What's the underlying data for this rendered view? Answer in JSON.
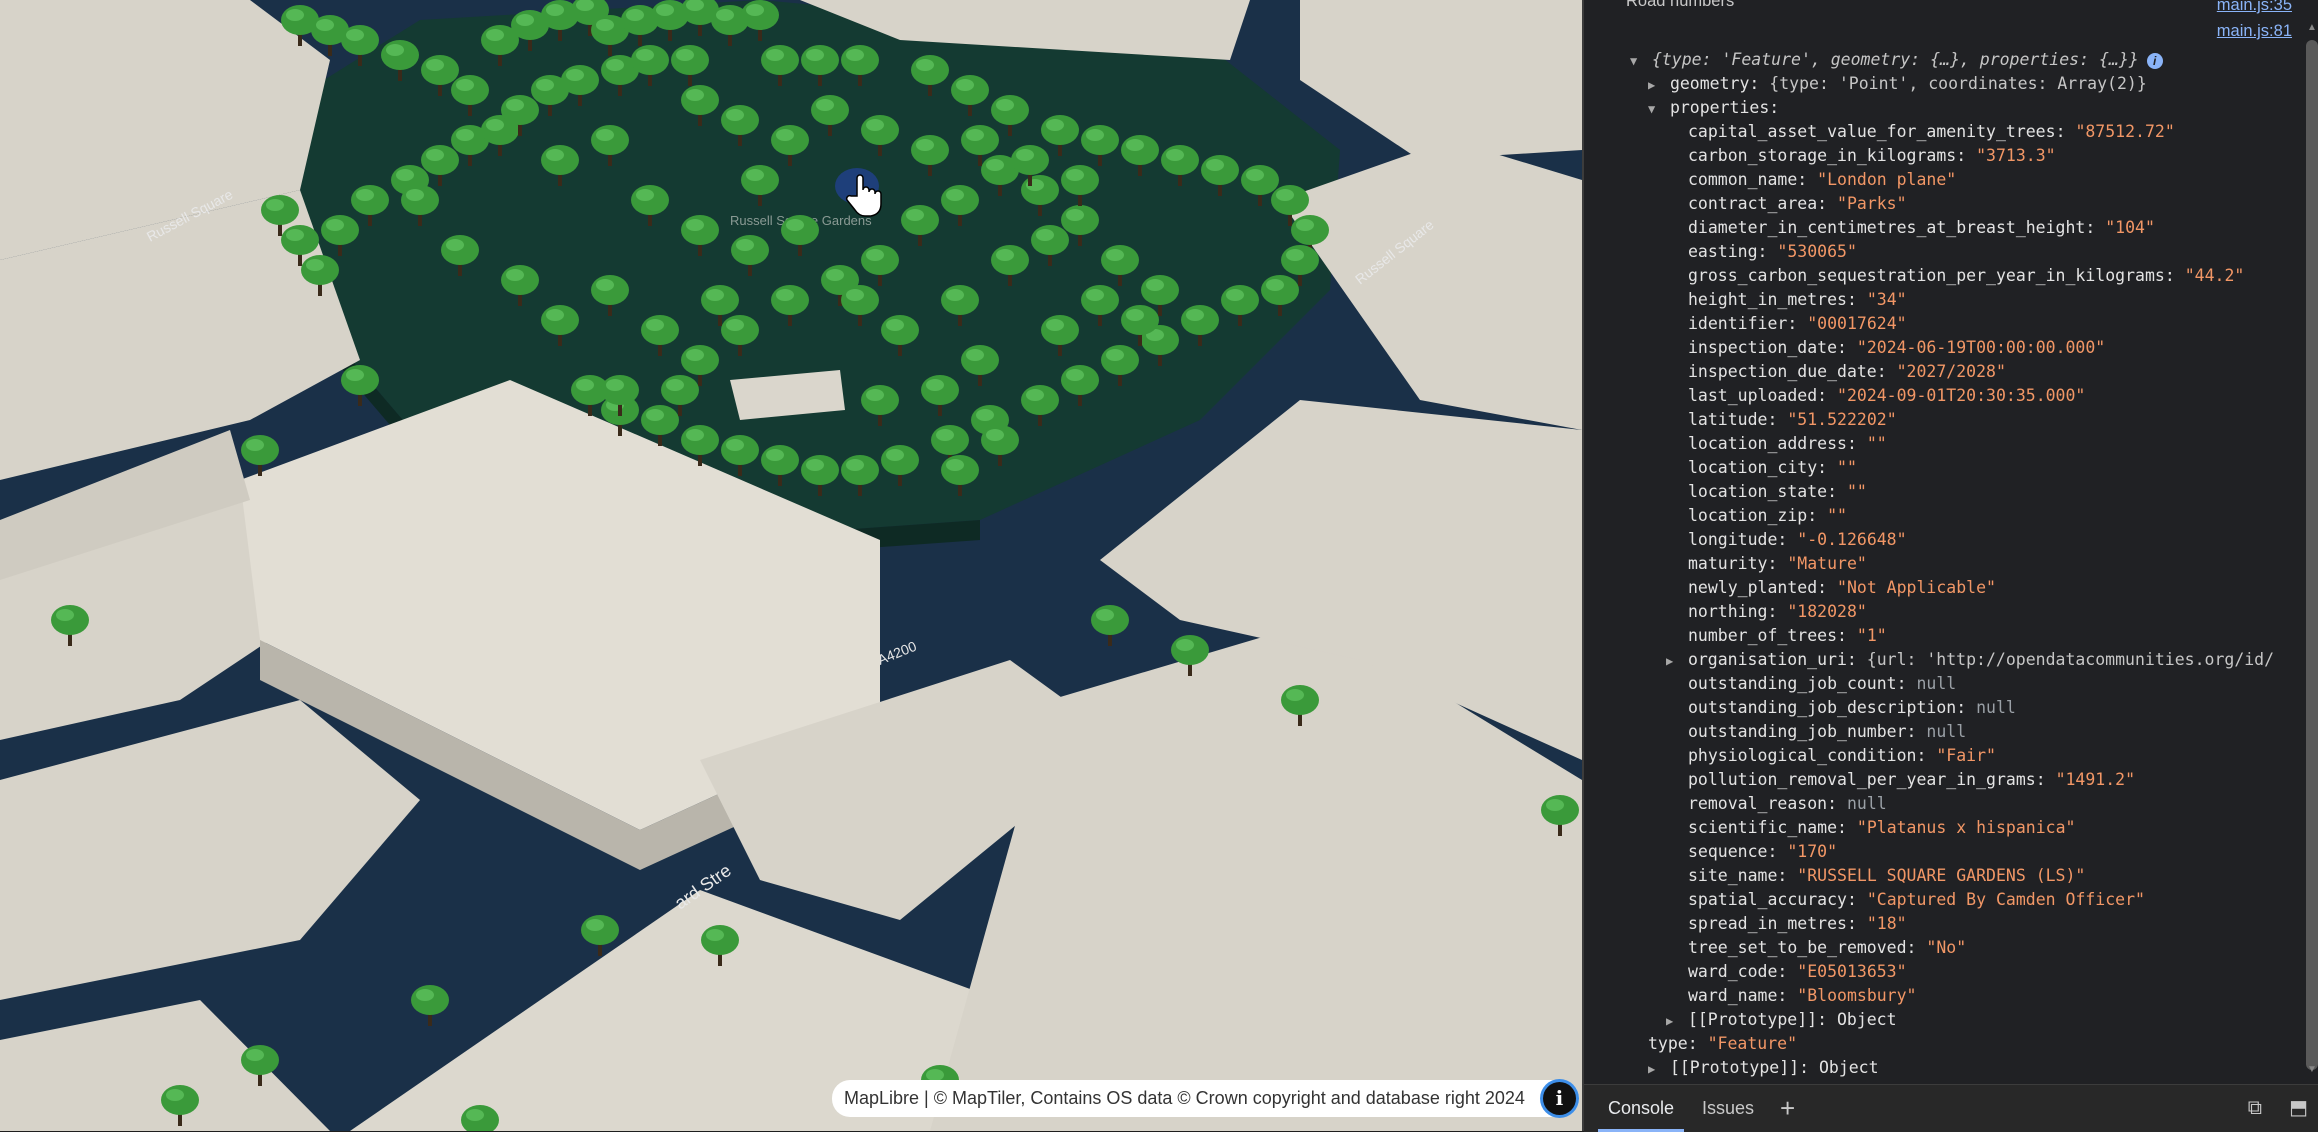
{
  "map": {
    "labels": {
      "russell_square_left": "Russell Square",
      "russell_square_right": "Russell Square",
      "russell_square_gardens": "Russell Square Gardens",
      "a4200_top": "A4200",
      "a4200_bottom": "A4200",
      "road_top_left": "A4200",
      "street_bottom": "ard Stre"
    },
    "attribution": "MapLibre | © MapTiler, Contains OS data © Crown copyright and database right 2024",
    "attribution_icon": "info-icon"
  },
  "devtools": {
    "top_partial_label": "Road numbers",
    "source_links": [
      "main.js:35",
      "main.js:81"
    ],
    "object_summary": "{type: 'Feature', geometry: {…}, properties: {…}}",
    "geometry_summary": "{type: 'Point', coordinates: Array(2)}",
    "geometry_key": "geometry",
    "properties_key": "properties",
    "properties": [
      {
        "key": "capital_asset_value_for_amenity_trees",
        "value": "\"87512.72\"",
        "kind": "str"
      },
      {
        "key": "carbon_storage_in_kilograms",
        "value": "\"3713.3\"",
        "kind": "str"
      },
      {
        "key": "common_name",
        "value": "\"London plane\"",
        "kind": "str"
      },
      {
        "key": "contract_area",
        "value": "\"Parks\"",
        "kind": "str"
      },
      {
        "key": "diameter_in_centimetres_at_breast_height",
        "value": "\"104\"",
        "kind": "str"
      },
      {
        "key": "easting",
        "value": "\"530065\"",
        "kind": "str"
      },
      {
        "key": "gross_carbon_sequestration_per_year_in_kilograms",
        "value": "\"44.2\"",
        "kind": "str"
      },
      {
        "key": "height_in_metres",
        "value": "\"34\"",
        "kind": "str"
      },
      {
        "key": "identifier",
        "value": "\"00017624\"",
        "kind": "str"
      },
      {
        "key": "inspection_date",
        "value": "\"2024-06-19T00:00:00.000\"",
        "kind": "str"
      },
      {
        "key": "inspection_due_date",
        "value": "\"2027/2028\"",
        "kind": "str"
      },
      {
        "key": "last_uploaded",
        "value": "\"2024-09-01T20:30:35.000\"",
        "kind": "str"
      },
      {
        "key": "latitude",
        "value": "\"51.522202\"",
        "kind": "str"
      },
      {
        "key": "location_address",
        "value": "\"\"",
        "kind": "str"
      },
      {
        "key": "location_city",
        "value": "\"\"",
        "kind": "str"
      },
      {
        "key": "location_state",
        "value": "\"\"",
        "kind": "str"
      },
      {
        "key": "location_zip",
        "value": "\"\"",
        "kind": "str"
      },
      {
        "key": "longitude",
        "value": "\"-0.126648\"",
        "kind": "str"
      },
      {
        "key": "maturity",
        "value": "\"Mature\"",
        "kind": "str"
      },
      {
        "key": "newly_planted",
        "value": "\"Not Applicable\"",
        "kind": "str"
      },
      {
        "key": "northing",
        "value": "\"182028\"",
        "kind": "str"
      },
      {
        "key": "number_of_trees",
        "value": "\"1\"",
        "kind": "str"
      },
      {
        "key": "organisation_uri",
        "value": "{url: 'http://opendatacommunities.org/id/",
        "kind": "obj"
      },
      {
        "key": "outstanding_job_count",
        "value": "null",
        "kind": "null"
      },
      {
        "key": "outstanding_job_description",
        "value": "null",
        "kind": "null"
      },
      {
        "key": "outstanding_job_number",
        "value": "null",
        "kind": "null"
      },
      {
        "key": "physiological_condition",
        "value": "\"Fair\"",
        "kind": "str"
      },
      {
        "key": "pollution_removal_per_year_in_grams",
        "value": "\"1491.2\"",
        "kind": "str"
      },
      {
        "key": "removal_reason",
        "value": "null",
        "kind": "null"
      },
      {
        "key": "scientific_name",
        "value": "\"Platanus x hispanica\"",
        "kind": "str"
      },
      {
        "key": "sequence",
        "value": "\"170\"",
        "kind": "str"
      },
      {
        "key": "site_name",
        "value": "\"RUSSELL SQUARE GARDENS (LS)\"",
        "kind": "str"
      },
      {
        "key": "spatial_accuracy",
        "value": "\"Captured By Camden Officer\"",
        "kind": "str"
      },
      {
        "key": "spread_in_metres",
        "value": "\"18\"",
        "kind": "str"
      },
      {
        "key": "tree_set_to_be_removed",
        "value": "\"No\"",
        "kind": "str"
      },
      {
        "key": "ward_code",
        "value": "\"E05013653\"",
        "kind": "str"
      },
      {
        "key": "ward_name",
        "value": "\"Bloomsbury\"",
        "kind": "str"
      }
    ],
    "prototype_inner": "[[Prototype]]: Object",
    "type_line_key": "type",
    "type_line_value": "\"Feature\"",
    "prototype_outer": "[[Prototype]]: Object",
    "drawer": {
      "tabs": [
        "Console",
        "Issues"
      ],
      "add_icon": "plus-icon",
      "right_icons": [
        "dock-icon",
        "undock-icon"
      ]
    }
  },
  "colors": {
    "tree_green": "#3a9a3a",
    "park_fill": "#143a32",
    "building": "#d7d3c9",
    "street": "#1a3048",
    "string_value": "#f29766",
    "link": "#8ab4f8"
  }
}
